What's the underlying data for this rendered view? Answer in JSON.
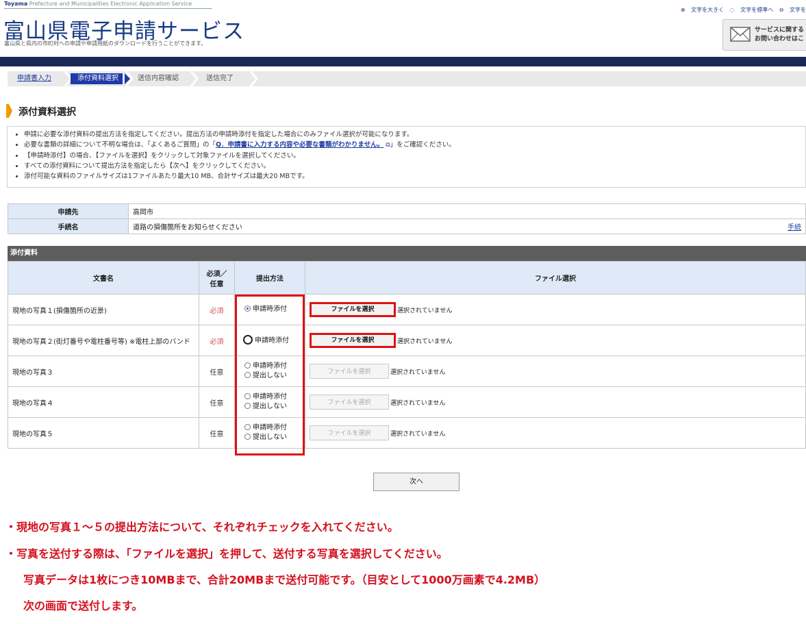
{
  "header": {
    "brand_strong": "Toyama",
    "brand_rest": "Prefecture and Municipalities Electronic Application Service",
    "title": "富山県電子申請サービス",
    "subtitle": "富山県と県内の市町村への申請や申請用紙のダウンロードを行うことができます。",
    "text_size": [
      "文字を大きく",
      "文字を標準へ",
      "文字を"
    ],
    "contact_line1": "サービスに関する",
    "contact_line2": "お問い合わせはこ"
  },
  "steps": [
    "申請書入力",
    "添付資料選択",
    "送信内容確認",
    "送信完了"
  ],
  "page_title": "添付資料選択",
  "instructions": {
    "item1": "申請に必要な添付資料の提出方法を指定してください。提出方法の申請時添付を指定した場合にのみファイル選択が可能になります。",
    "item2_pre": "必要な書類の詳細について不明な場合は、「よくあるご質問」の「",
    "item2_link": "Q．申請書に入力する内容や必要な書類がわかりません。",
    "item2_post": "」をご確認ください。",
    "item3": "【申請時添付】の場合、【ファイルを選択】をクリックして対象ファイルを選択してください。",
    "item4": "すべての添付資料について提出方法を指定したら【次へ】をクリックしてください。",
    "item5": "添付可能な資料のファイルサイズは1ファイルあたり最大10 MB、合計サイズは最大20 MBです。"
  },
  "info": {
    "dest_label": "申請先",
    "dest_value": "高岡市",
    "proc_label": "手続名",
    "proc_value": "道路の損傷箇所をお知らせください",
    "proc_link": "手続"
  },
  "attachments": {
    "heading": "添付資料",
    "col_doc": "文書名",
    "col_req_1": "必須／",
    "col_req_2": "任意",
    "col_method": "提出方法",
    "col_file": "ファイル選択",
    "method_attach": "申請時添付",
    "method_none": "提出しない",
    "file_button": "ファイルを選択",
    "no_file": "選択されていません",
    "rows": [
      {
        "name": "現地の写真１(損傷箇所の近景)",
        "req": "必須"
      },
      {
        "name": "現地の写真２(街灯番号や電柱番号等) ※電柱上部のバンド",
        "req": "必須"
      },
      {
        "name": "現地の写真３",
        "req": "任意"
      },
      {
        "name": "現地の写真４",
        "req": "任意"
      },
      {
        "name": "現地の写真５",
        "req": "任意"
      }
    ]
  },
  "next_button": "次へ",
  "notes": {
    "line1": "・現地の写真１～５の提出方法について、それぞれチェックを入れてください。",
    "line2": "・写真を送付する際は、「ファイルを選択」を押して、送付する写真を選択してください。",
    "line3": "写真データは1枚につき10MBまで、合計20MBまで送付可能です。（目安として1000万画素で4.2MB）",
    "line4": "次の画面で送付します。"
  },
  "colors": {
    "accent_red": "#e01010",
    "title_blue": "#173a82",
    "step_current": "#1f3aa6",
    "heading_bar": "#f29a00"
  }
}
